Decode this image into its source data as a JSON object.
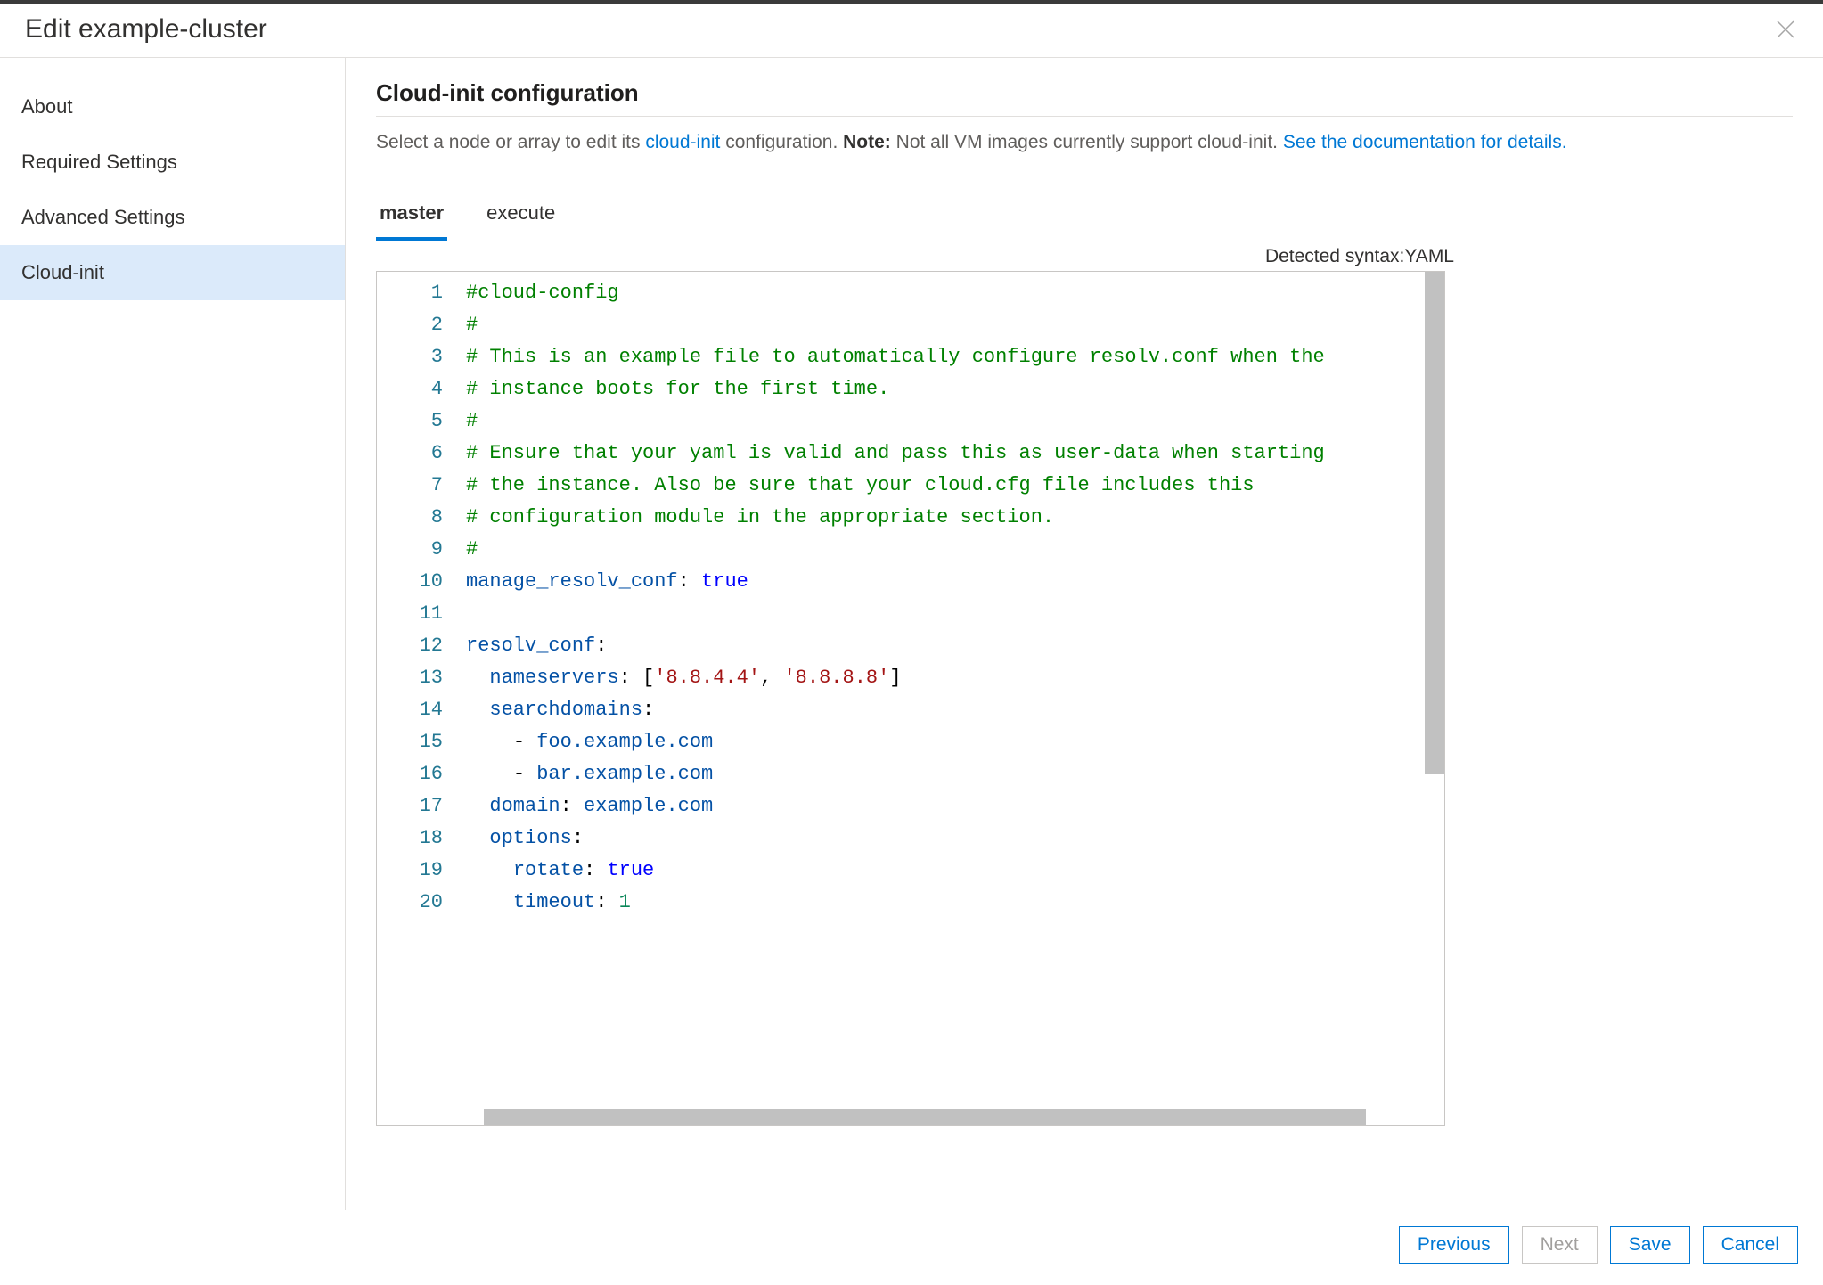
{
  "dialog": {
    "title": "Edit example-cluster"
  },
  "sidebar": {
    "items": [
      {
        "label": "About",
        "active": false
      },
      {
        "label": "Required Settings",
        "active": false
      },
      {
        "label": "Advanced Settings",
        "active": false
      },
      {
        "label": "Cloud-init",
        "active": true
      }
    ]
  },
  "main": {
    "section_title": "Cloud-init configuration",
    "subtext_prefix": "Select a node or array to edit its ",
    "subtext_link1": "cloud-init",
    "subtext_mid": " configuration. ",
    "subtext_note_label": "Note:",
    "subtext_note_body": " Not all VM images currently support cloud-init. ",
    "subtext_link2": "See the documentation for details."
  },
  "tabs": [
    {
      "label": "master",
      "active": true
    },
    {
      "label": "execute",
      "active": false
    }
  ],
  "syntax": {
    "label": "Detected syntax: ",
    "value": "YAML"
  },
  "editor": {
    "lines": [
      {
        "n": 1,
        "t": "comment",
        "text": "#cloud-config"
      },
      {
        "n": 2,
        "t": "comment",
        "text": "#"
      },
      {
        "n": 3,
        "t": "comment",
        "text": "# This is an example file to automatically configure resolv.conf when the"
      },
      {
        "n": 4,
        "t": "comment",
        "text": "# instance boots for the first time."
      },
      {
        "n": 5,
        "t": "comment",
        "text": "#"
      },
      {
        "n": 6,
        "t": "comment",
        "text": "# Ensure that your yaml is valid and pass this as user-data when starting"
      },
      {
        "n": 7,
        "t": "comment",
        "text": "# the instance. Also be sure that your cloud.cfg file includes this"
      },
      {
        "n": 8,
        "t": "comment",
        "text": "# configuration module in the appropriate section."
      },
      {
        "n": 9,
        "t": "comment",
        "text": "#"
      },
      {
        "n": 10,
        "t": "kv",
        "key": "manage_resolv_conf",
        "val_type": "bool",
        "val": "true"
      },
      {
        "n": 11,
        "t": "blank"
      },
      {
        "n": 12,
        "t": "key",
        "key": "resolv_conf"
      },
      {
        "n": 13,
        "t": "kv_indent",
        "indent": 1,
        "key": "nameservers",
        "raw_after": ": [",
        "strings": [
          "'8.8.4.4'",
          "'8.8.8.8'"
        ],
        "raw_end": "]"
      },
      {
        "n": 14,
        "t": "key_indent",
        "indent": 1,
        "key": "searchdomains"
      },
      {
        "n": 15,
        "t": "list_item",
        "indent": 2,
        "val": "foo.example.com"
      },
      {
        "n": 16,
        "t": "list_item",
        "indent": 2,
        "val": "bar.example.com"
      },
      {
        "n": 17,
        "t": "kv_indent",
        "indent": 1,
        "key": "domain",
        "val_type": "plain",
        "val": "example.com"
      },
      {
        "n": 18,
        "t": "key_indent",
        "indent": 1,
        "key": "options"
      },
      {
        "n": 19,
        "t": "kv_indent",
        "indent": 2,
        "key": "rotate",
        "val_type": "bool",
        "val": "true"
      },
      {
        "n": 20,
        "t": "kv_indent",
        "indent": 2,
        "key": "timeout",
        "val_type": "num",
        "val": "1"
      }
    ]
  },
  "footer": {
    "previous": "Previous",
    "next": "Next",
    "save": "Save",
    "cancel": "Cancel"
  }
}
